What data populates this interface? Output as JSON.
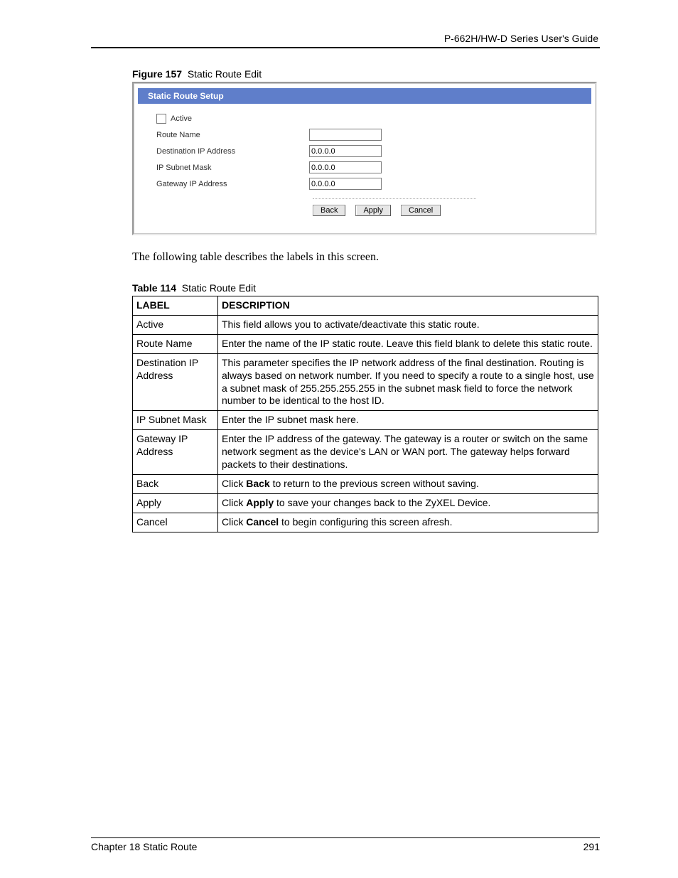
{
  "running_head": "P-662H/HW-D Series User's Guide",
  "figure": {
    "caption_label": "Figure 157",
    "caption_text": "Static Route Edit"
  },
  "panel": {
    "title": "Static Route Setup",
    "active_label": "Active",
    "fields": {
      "route_name": {
        "label": "Route Name",
        "value": ""
      },
      "dest_ip": {
        "label": "Destination IP Address",
        "value": "0.0.0.0"
      },
      "subnet": {
        "label": "IP Subnet Mask",
        "value": "0.0.0.0"
      },
      "gateway": {
        "label": "Gateway IP Address",
        "value": "0.0.0.0"
      }
    },
    "buttons": {
      "back": "Back",
      "apply": "Apply",
      "cancel": "Cancel"
    }
  },
  "body_text": "The following table describes the labels in this screen.",
  "table": {
    "caption_label": "Table 114",
    "caption_text": "Static Route Edit",
    "head": {
      "label": "LABEL",
      "desc": "DESCRIPTION"
    },
    "rows": [
      {
        "label": "Active",
        "desc_plain": "This field allows you to activate/deactivate this static route."
      },
      {
        "label": "Route Name",
        "desc_plain": "Enter the name of the IP static route. Leave this field blank to delete this static route."
      },
      {
        "label": "Destination IP Address",
        "desc_plain": "This parameter specifies the IP network address of the final destination.  Routing is always based on network number. If you need to specify a route to a single host, use a subnet mask of 255.255.255.255 in the subnet mask field to force the network number to be identical to the host ID."
      },
      {
        "label": "IP Subnet Mask",
        "desc_plain": "Enter the IP subnet mask here."
      },
      {
        "label": "Gateway IP Address",
        "desc_plain": "Enter the IP address of the gateway. The gateway is a router or switch on the same network segment as the device's LAN or WAN port. The gateway helps forward packets to their destinations."
      },
      {
        "label": "Back",
        "desc_pre": "Click ",
        "desc_bold": "Back",
        "desc_post": " to return to the previous screen without saving."
      },
      {
        "label": "Apply",
        "desc_pre": "Click ",
        "desc_bold": "Apply",
        "desc_post": " to save your changes back to the ZyXEL Device."
      },
      {
        "label": "Cancel",
        "desc_pre": "Click ",
        "desc_bold": "Cancel",
        "desc_post": " to begin configuring this screen afresh."
      }
    ]
  },
  "footer": {
    "chapter": "Chapter 18 Static Route",
    "page": "291"
  }
}
